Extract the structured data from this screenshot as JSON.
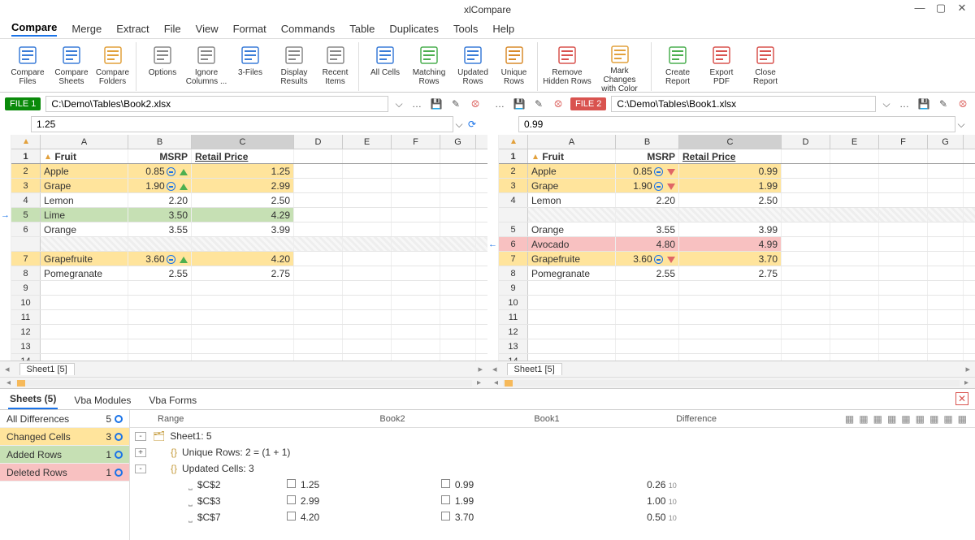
{
  "app": {
    "title": "xlCompare"
  },
  "menu": [
    "Compare",
    "Merge",
    "Extract",
    "File",
    "View",
    "Format",
    "Commands",
    "Table",
    "Duplicates",
    "Tools",
    "Help"
  ],
  "ribbon": [
    {
      "l1": "Compare",
      "l2": "Files"
    },
    {
      "l1": "Compare",
      "l2": "Sheets"
    },
    {
      "l1": "Compare",
      "l2": "Folders"
    },
    {
      "l1": "Options",
      "l2": ""
    },
    {
      "l1": "Ignore",
      "l2": "Columns ..."
    },
    {
      "l1": "3-Files",
      "l2": ""
    },
    {
      "l1": "Display",
      "l2": "Results"
    },
    {
      "l1": "Recent",
      "l2": "Items"
    },
    {
      "l1": "All Cells",
      "l2": ""
    },
    {
      "l1": "Matching",
      "l2": "Rows"
    },
    {
      "l1": "Updated",
      "l2": "Rows"
    },
    {
      "l1": "Unique",
      "l2": "Rows"
    },
    {
      "l1": "Remove",
      "l2": "Hidden Rows"
    },
    {
      "l1": "Mark Changes",
      "l2": "with Color"
    },
    {
      "l1": "Create",
      "l2": "Report"
    },
    {
      "l1": "Export",
      "l2": "PDF"
    },
    {
      "l1": "Close",
      "l2": "Report"
    }
  ],
  "left": {
    "tag": "FILE 1",
    "path": "C:\\Demo\\Tables\\Book2.xlsx",
    "value": "1.25",
    "cols": [
      "A",
      "B",
      "C",
      "D",
      "E",
      "F",
      "G"
    ],
    "headers": [
      "Fruit",
      "MSRP",
      "Retail Price"
    ],
    "rows": [
      {
        "n": "2",
        "a": "Apple",
        "b": "0.85",
        "c": "1.25",
        "cls": "yellow",
        "mark": "up"
      },
      {
        "n": "3",
        "a": "Grape",
        "b": "1.90",
        "c": "2.99",
        "cls": "yellow",
        "mark": "up"
      },
      {
        "n": "4",
        "a": "Lemon",
        "b": "2.20",
        "c": "2.50",
        "cls": ""
      },
      {
        "n": "5",
        "a": "Lime",
        "b": "3.50",
        "c": "4.29",
        "cls": "green",
        "gut": "→"
      },
      {
        "n": "6",
        "a": "Orange",
        "b": "3.55",
        "c": "3.99",
        "cls": ""
      },
      {
        "n": "",
        "a": "",
        "b": "",
        "c": "",
        "cls": "gap"
      },
      {
        "n": "7",
        "a": "Grapefruite",
        "b": "3.60",
        "c": "4.20",
        "cls": "yellow",
        "mark": "up"
      },
      {
        "n": "8",
        "a": "Pomegranate",
        "b": "2.55",
        "c": "2.75",
        "cls": ""
      }
    ],
    "sheet": "Sheet1 [5]"
  },
  "right": {
    "tag": "FILE 2",
    "path": "C:\\Demo\\Tables\\Book1.xlsx",
    "value": "0.99",
    "cols": [
      "A",
      "B",
      "C",
      "D",
      "E",
      "F",
      "G"
    ],
    "headers": [
      "Fruit",
      "MSRP",
      "Retail Price"
    ],
    "rows": [
      {
        "n": "2",
        "a": "Apple",
        "b": "0.85",
        "c": "0.99",
        "cls": "yellow",
        "mark": "dn"
      },
      {
        "n": "3",
        "a": "Grape",
        "b": "1.90",
        "c": "1.99",
        "cls": "yellow",
        "mark": "dn"
      },
      {
        "n": "4",
        "a": "Lemon",
        "b": "2.20",
        "c": "2.50",
        "cls": ""
      },
      {
        "n": "",
        "a": "",
        "b": "",
        "c": "",
        "cls": "gap"
      },
      {
        "n": "5",
        "a": "Orange",
        "b": "3.55",
        "c": "3.99",
        "cls": ""
      },
      {
        "n": "6",
        "a": "Avocado",
        "b": "4.80",
        "c": "4.99",
        "cls": "pink",
        "gut": "←"
      },
      {
        "n": "7",
        "a": "Grapefruite",
        "b": "3.60",
        "c": "3.70",
        "cls": "yellow",
        "mark": "dn"
      },
      {
        "n": "8",
        "a": "Pomegranate",
        "b": "2.55",
        "c": "2.75",
        "cls": ""
      }
    ],
    "sheet": "Sheet1 [5]"
  },
  "diff": {
    "tabs": [
      "Sheets (5)",
      "Vba Modules",
      "Vba Forms"
    ],
    "legend": [
      {
        "label": "All Differences",
        "count": "5",
        "cls": ""
      },
      {
        "label": "Changed Cells",
        "count": "3",
        "cls": "chg"
      },
      {
        "label": "Added Rows",
        "count": "1",
        "cls": "add"
      },
      {
        "label": "Deleted Rows",
        "count": "1",
        "cls": "del"
      }
    ],
    "thead": [
      "Range",
      "Book2",
      "Book1",
      "Difference"
    ],
    "tree": [
      {
        "lvl": 0,
        "exp": "-",
        "ic": "sheet",
        "txt": "Sheet1: 5"
      },
      {
        "lvl": 1,
        "exp": "+",
        "ic": "uniq",
        "txt": "Unique Rows: 2 = (1 + 1)"
      },
      {
        "lvl": 1,
        "exp": "-",
        "ic": "upd",
        "txt": "Updated Cells: 3"
      },
      {
        "lvl": 2,
        "range": "$C$2",
        "b2": "1.25",
        "b1": "0.99",
        "d": "0.26"
      },
      {
        "lvl": 2,
        "range": "$C$3",
        "b2": "2.99",
        "b1": "1.99",
        "d": "1.00"
      },
      {
        "lvl": 2,
        "range": "$C$7",
        "b2": "4.20",
        "b1": "3.70",
        "d": "0.50"
      }
    ]
  }
}
